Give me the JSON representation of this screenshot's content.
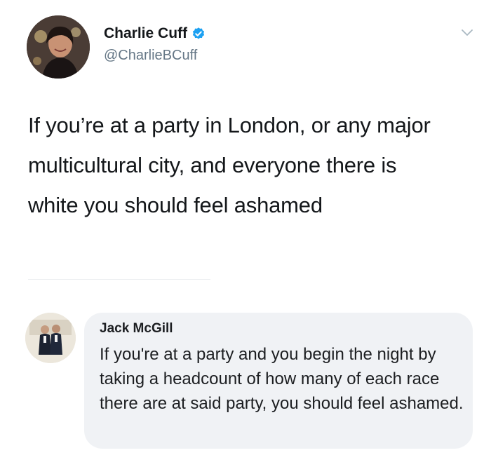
{
  "tweet": {
    "author_name": "Charlie Cuff",
    "author_handle": "@CharlieBCuff",
    "text": "If you’re at a party in London, or any major multicultural city, and everyone there is white you should feel ashamed"
  },
  "reply": {
    "author_name": "Jack McGill",
    "text": "If you're at a party and you begin the night by taking a headcount of how many of each race there are at said party, you should feel ashamed."
  },
  "colors": {
    "verified": "#1da1f2",
    "handle": "#657786",
    "bubble": "#f0f2f5"
  },
  "icons": [
    "verified-icon",
    "chevron-down-icon"
  ]
}
